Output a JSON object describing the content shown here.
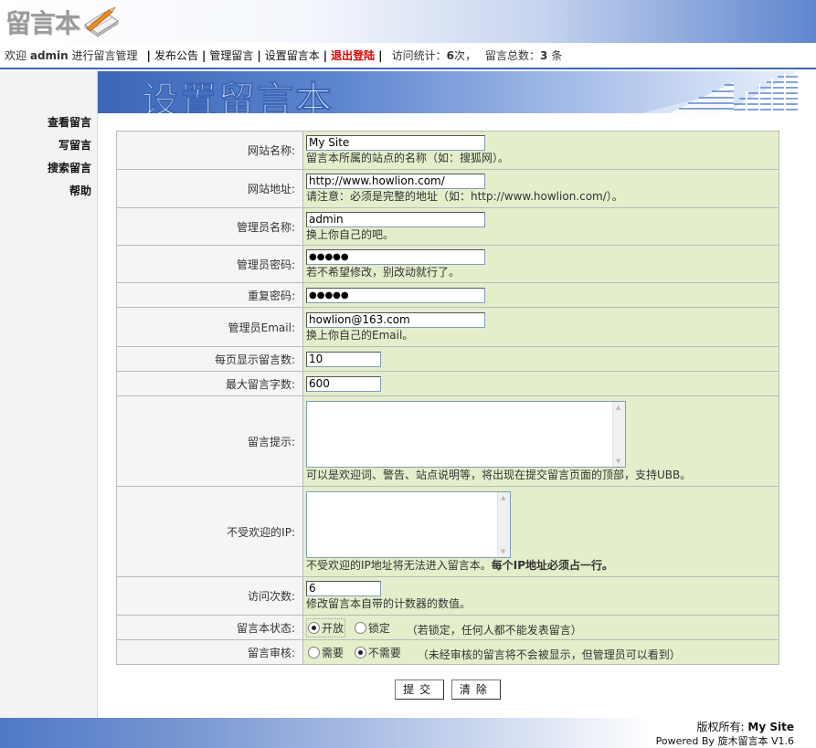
{
  "header": {
    "logo_text": "留言本"
  },
  "navbar": {
    "welcome_prefix": "欢迎",
    "user": "admin",
    "welcome_suffix": "进行留言管理",
    "links": [
      "发布公告",
      "管理留言",
      "设置留言本"
    ],
    "logout": "退出登陆",
    "stats_label": "访问统计：",
    "visits": "6",
    "visits_unit": "次，",
    "total_label": "留言总数：",
    "total": "3",
    "total_unit": "条"
  },
  "sidebar": {
    "items": [
      "查看留言",
      "写留言",
      "搜索留言",
      "帮助"
    ]
  },
  "banner": {
    "title": "设置留言本"
  },
  "form": {
    "site_name": {
      "label": "网站名称:",
      "value": "My Site",
      "hint": "留言本所属的站点的名称（如：搜狐网）。"
    },
    "site_url": {
      "label": "网站地址:",
      "value": "http://www.howlion.com/",
      "hint": "请注意：必须是完整的地址（如：http://www.howlion.com/）。"
    },
    "admin_name": {
      "label": "管理员名称:",
      "value": "admin",
      "hint": "换上你自己的吧。"
    },
    "admin_pass": {
      "label": "管理员密码:",
      "value": "●●●●●",
      "hint": "若不希望修改，别改动就行了。"
    },
    "repeat_pass": {
      "label": "重复密码:",
      "value": "●●●●●"
    },
    "admin_email": {
      "label": "管理员Email:",
      "value": "howlion@163.com",
      "hint": "换上你自己的Email。"
    },
    "per_page": {
      "label": "每页显示留言数:",
      "value": "10"
    },
    "max_chars": {
      "label": "最大留言字数:",
      "value": "600"
    },
    "notice": {
      "label": "留言提示:",
      "value": "",
      "hint": "可以是欢迎词、警告、站点说明等，将出现在提交留言页面的顶部，支持UBB。"
    },
    "blocked_ip": {
      "label": "不受欢迎的IP:",
      "value": "",
      "hint": "不受欢迎的IP地址将无法进入留言本。",
      "hint_bold": "每个IP地址必须占一行。"
    },
    "visit_count": {
      "label": "访问次数:",
      "value": "6",
      "hint": "修改留言本自带的计数器的数值。"
    },
    "status": {
      "label": "留言本状态:",
      "opt1": "开放",
      "opt2": "锁定",
      "note": "（若锁定，任何人都不能发表留言）",
      "selected": "开放"
    },
    "review": {
      "label": "留言审核:",
      "opt1": "需要",
      "opt2": "不需要",
      "note": "（未经审核的留言将不会被显示，但管理员可以看到）",
      "selected": "不需要"
    }
  },
  "buttons": {
    "submit": "提交",
    "reset": "清除"
  },
  "footer": {
    "copyright_label": "版权所有:",
    "copyright_owner": "My Site",
    "powered_prefix": "Powered By",
    "powered_name": "旋木留言本",
    "version": "V1.6"
  }
}
